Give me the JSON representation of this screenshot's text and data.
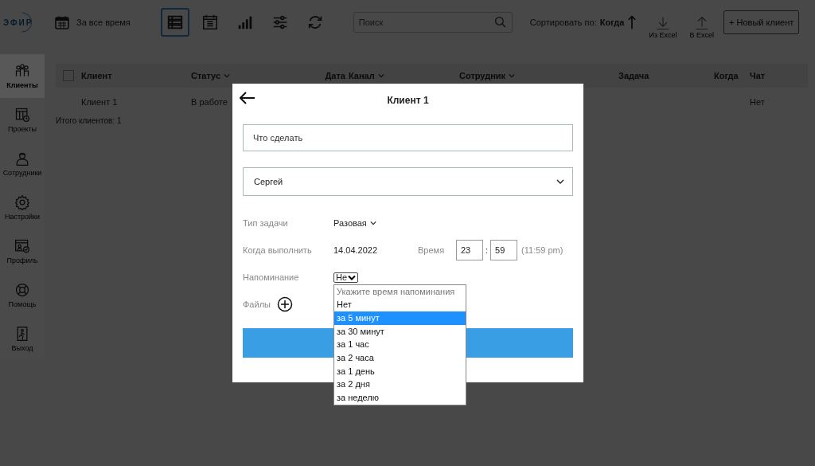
{
  "logo": {
    "text": "ЭФИР"
  },
  "period": {
    "label": "За все время"
  },
  "views": [
    {
      "kind": "list",
      "selected": true
    },
    {
      "kind": "calendar",
      "selected": false
    },
    {
      "kind": "chart",
      "selected": false
    },
    {
      "kind": "filters",
      "selected": false
    },
    {
      "kind": "refresh",
      "selected": false
    }
  ],
  "search": {
    "placeholder": "Поиск"
  },
  "sort": {
    "label": "Сортировать по:",
    "value": "Когда"
  },
  "excel": [
    {
      "kind": "import",
      "label": "Из Excel"
    },
    {
      "kind": "export",
      "label": "В Excel"
    }
  ],
  "new_client_button": "+ Новый клиент",
  "sidebar": {
    "items": [
      {
        "kind": "clients",
        "label": "Клиенты",
        "selected": true
      },
      {
        "kind": "projects",
        "label": "Проекты",
        "selected": false
      },
      {
        "kind": "staff",
        "label": "Сотрудники",
        "selected": false
      },
      {
        "kind": "settings",
        "label": "Настройки",
        "selected": false
      },
      {
        "kind": "profile",
        "label": "Профиль",
        "selected": false
      },
      {
        "kind": "help",
        "label": "Помощь",
        "selected": false
      },
      {
        "kind": "exit",
        "label": "Выход",
        "selected": false
      }
    ]
  },
  "table": {
    "select_all": {
      "checked": false
    },
    "columns": [
      {
        "label": "Клиент",
        "dropdown": false
      },
      {
        "label": "Статус",
        "dropdown": true
      },
      {
        "label": "Дата",
        "dropdown": false
      },
      {
        "label": "Канал",
        "dropdown": true
      },
      {
        "label": "Сотрудник",
        "dropdown": true
      },
      {
        "label": "Задача",
        "dropdown": false
      },
      {
        "label": "Когда",
        "dropdown": false
      },
      {
        "label": "Чат",
        "dropdown": false
      }
    ],
    "rows": [
      {
        "client": "Клиент 1",
        "status": "В работе",
        "chat": "Нет"
      }
    ]
  },
  "total": "Итого клиентов: 1",
  "modal": {
    "title": "Клиент 1",
    "task_field": {
      "placeholder": "Что сделать"
    },
    "employee_select": {
      "value": "Сергей"
    },
    "task_type": {
      "label": "Тип задачи",
      "value": "Разовая"
    },
    "due": {
      "label": "Когда выполнить",
      "date": "14.04.2022",
      "time_label": "Время",
      "hours": "23",
      "separator": ":",
      "minutes": "59",
      "time_12h": "(11:59 pm)"
    },
    "reminder": {
      "label": "Напоминание",
      "value": "Не",
      "open": true,
      "options": [
        {
          "label": "Укажите время напоминания",
          "disabled": true,
          "selected": false
        },
        {
          "label": "Нет",
          "disabled": false,
          "selected": false
        },
        {
          "label": "за 5 минут",
          "disabled": false,
          "selected": true
        },
        {
          "label": "за 30 минут",
          "disabled": false,
          "selected": false
        },
        {
          "label": "за 1 час",
          "disabled": false,
          "selected": false
        },
        {
          "label": "за 2 часа",
          "disabled": false,
          "selected": false
        },
        {
          "label": "за 1 день",
          "disabled": false,
          "selected": false
        },
        {
          "label": "за 2 дня",
          "disabled": false,
          "selected": false
        },
        {
          "label": "за неделю",
          "disabled": false,
          "selected": false
        }
      ]
    },
    "files_label": "Файлы"
  }
}
